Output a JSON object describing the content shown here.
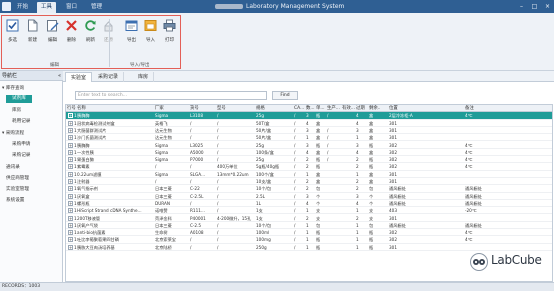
{
  "window": {
    "app_title": "Laboratory Management System",
    "tabs": [
      {
        "label": "开始"
      },
      {
        "label": "工具"
      },
      {
        "label": "窗口"
      },
      {
        "label": "管理"
      }
    ]
  },
  "toolbar": {
    "buttons": [
      {
        "label": "多选",
        "icon": "checkbox-icon"
      },
      {
        "label": "新建",
        "icon": "new-document-icon"
      },
      {
        "label": "编辑",
        "icon": "edit-icon"
      },
      {
        "label": "删除",
        "icon": "delete-icon"
      },
      {
        "label": "刷新",
        "icon": "refresh-icon"
      },
      {
        "label": "还原",
        "icon": "restore-icon"
      },
      {
        "label": "导出",
        "icon": "export-icon"
      },
      {
        "label": "导入",
        "icon": "import-icon"
      },
      {
        "label": "打印",
        "icon": "print-icon"
      }
    ],
    "groups": [
      "编辑",
      "导入/导出"
    ]
  },
  "nav": {
    "header": "导航栏",
    "items": [
      {
        "label": "库存查询"
      },
      {
        "label": "试剂库"
      },
      {
        "label": "库房"
      },
      {
        "label": "耗用记录"
      },
      {
        "label": "采购流程"
      },
      {
        "label": "采购申请"
      },
      {
        "label": "采购记录"
      },
      {
        "label": "通讯录"
      },
      {
        "label": "供应商管理"
      },
      {
        "label": "实验室管理"
      },
      {
        "label": "系统设置"
      }
    ]
  },
  "doc_tabs": [
    {
      "label": "实验室"
    },
    {
      "label": "采购记录"
    },
    {
      "label": "库房"
    }
  ],
  "search": {
    "placeholder": "Enter text to search...",
    "button": "Find"
  },
  "grid": {
    "columns": [
      "行号",
      "名称",
      "厂家",
      "货号",
      "型号",
      "规格",
      "CA...",
      "数...",
      "单...",
      "生产...",
      "有效...",
      "过期",
      "剩余...",
      "",
      "位置",
      "备注"
    ],
    "rows": [
      [
        "1",
        "胰酶酶",
        "Sigma",
        "L3108",
        "/",
        "25g",
        "/",
        "3",
        "瓶",
        "/",
        "",
        "4",
        "盒",
        "",
        "2层冷冻柜-A",
        "4℃"
      ],
      [
        "1",
        "冠状病毒检测试剂盒",
        "英格飞",
        "/",
        "/",
        "50T/盒",
        "/",
        "4",
        "盒",
        "",
        "",
        "4",
        "盒",
        "",
        "301",
        ""
      ],
      [
        "1",
        "大肠菌群测试片",
        "达元生物",
        "/",
        "/",
        "50片/盒",
        "/",
        "3",
        "盒",
        "/",
        "",
        "3",
        "盒",
        "",
        "301",
        ""
      ],
      [
        "1",
        "沙门氏菌测试片",
        "达元生物",
        "/",
        "/",
        "50片/盒",
        "/",
        "1",
        "盒",
        "/",
        "",
        "1",
        "盒",
        "",
        "301",
        ""
      ],
      [
        "1",
        "胰酶酶",
        "Sigma",
        "L3025",
        "/",
        "25g",
        "/",
        "3",
        "瓶",
        "/",
        "",
        "3",
        "瓶",
        "",
        "302",
        "4℃"
      ],
      [
        "1",
        "一次性胰",
        "Sigma",
        "A5000",
        "/",
        "100条/盒",
        "/",
        "4",
        "盒",
        "/",
        "",
        "4",
        "盒",
        "",
        "302",
        "4℃"
      ],
      [
        "1",
        "胃蛋白酶",
        "Sigma",
        "P7000",
        "/",
        "25g",
        "/",
        "2",
        "瓶",
        "/",
        "",
        "2",
        "瓶",
        "",
        "302",
        "4℃"
      ],
      [
        "1",
        "紫霉素",
        "/",
        "/",
        "400万单位",
        "5g瓶/40g瓶",
        "/",
        "2",
        "瓶",
        "",
        "",
        "2",
        "瓶",
        "",
        "302",
        "4℃"
      ],
      [
        "1",
        "0.22um滤膜",
        "Sigma",
        "SLGA...",
        "13mm*0.22um",
        "100个/盒",
        "/",
        "1",
        "盒",
        "",
        "",
        "1",
        "盒",
        "",
        "301",
        ""
      ],
      [
        "1",
        "注射器",
        "/",
        "/",
        "/",
        "10支/盒",
        "/",
        "2",
        "盒",
        "",
        "",
        "2",
        "盒",
        "",
        "301",
        ""
      ],
      [
        "1",
        "氧气指示剂",
        "日本三菱",
        "C-22",
        "/",
        "10个/包",
        "/",
        "2",
        "包",
        "",
        "",
        "2",
        "包",
        "",
        "通风橱处",
        "通风橱处"
      ],
      [
        "1",
        "厌氧盒",
        "日本三菱",
        "C-2.5L",
        "/",
        "2.5L",
        "/",
        "3",
        "个",
        "",
        "",
        "3",
        "个",
        "",
        "通风橱处",
        "通风橱处"
      ],
      [
        "1",
        "螺形瓶",
        "DURAN",
        "/",
        "/",
        "1L",
        "/",
        "4",
        "个",
        "",
        "",
        "4",
        "个",
        "",
        "通风橱处",
        "通风橱处"
      ],
      [
        "1",
        "HiScript Strand cDNA Synthe...",
        "诺唯赞",
        "R111...",
        "/",
        "1支",
        "/",
        "1",
        "支",
        "",
        "",
        "1",
        "支",
        "",
        "403",
        "-20℃"
      ],
      [
        "1",
        "200T移液管",
        "菏泽金科",
        "P40001",
        "4-200微升，15孔",
        "1支",
        "/",
        "2",
        "支",
        "",
        "",
        "2",
        "支",
        "",
        "301",
        ""
      ],
      [
        "1",
        "厌氧产气袋",
        "日本三菱",
        "C-2.5",
        "/",
        "10个/包",
        "/",
        "1",
        "包",
        "",
        "",
        "1",
        "包",
        "",
        "通风橱处",
        "通风橱处"
      ],
      [
        "1",
        "anti-bio抗菌素",
        "生命树",
        "A0108",
        "/",
        "100ml",
        "/",
        "1",
        "瓶",
        "",
        "",
        "1",
        "瓶",
        "",
        "302",
        "4℃"
      ],
      [
        "1",
        "吐比李葡聚萄果四甘磷",
        "北京索莱宝",
        "/",
        "/",
        "100mg",
        "/",
        "1",
        "瓶",
        "",
        "",
        "1",
        "瓶",
        "",
        "302",
        "4℃"
      ],
      [
        "1",
        "胰胨大豆肉汤培养基",
        "北京陆桥",
        "/",
        "/",
        "250g",
        "/",
        "1",
        "瓶",
        "",
        "",
        "1",
        "瓶",
        "",
        "301",
        ""
      ]
    ]
  },
  "status": {
    "text": "RECORDS：1003"
  },
  "watermark": {
    "text": "LabCube"
  },
  "colors": {
    "accent": "#1f9c98",
    "titlebar": "#2f5f93",
    "highlight_box": "#e35f57"
  }
}
